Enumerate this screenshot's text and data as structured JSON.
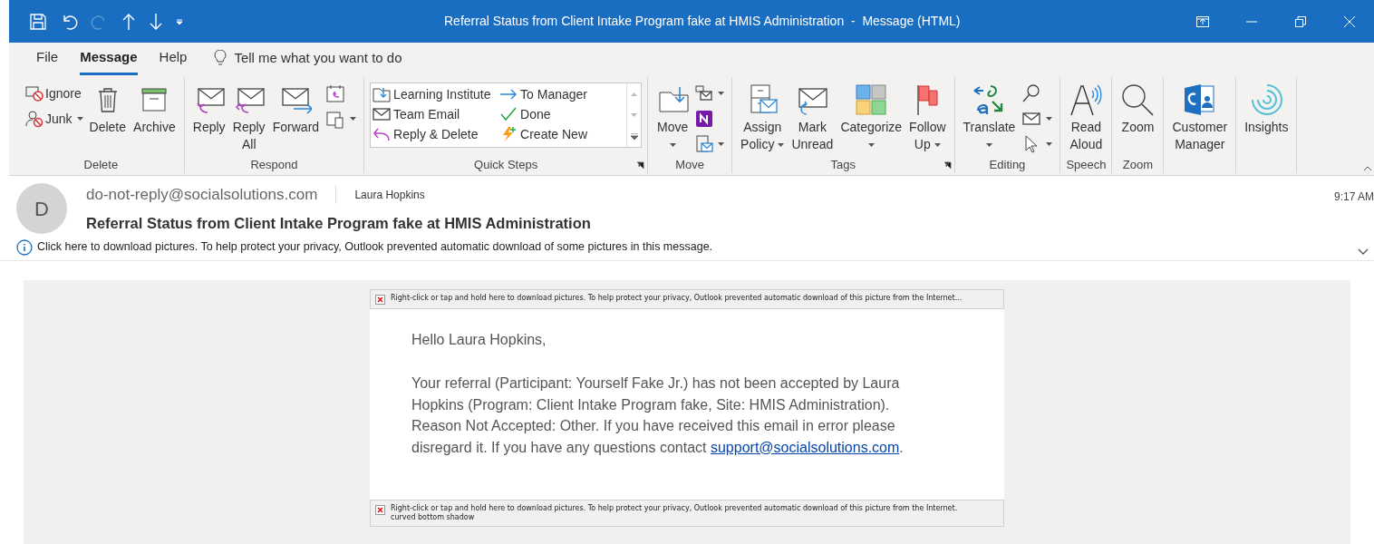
{
  "title_bar": {
    "title": "Referral Status from Client Intake Program fake at HMIS Administration  -  Message (HTML)"
  },
  "menu_tabs": [
    {
      "label": "File",
      "selected": false
    },
    {
      "label": "Message",
      "selected": true
    },
    {
      "label": "Help",
      "selected": false
    }
  ],
  "tell_me": {
    "placeholder": "Tell me what you want to do"
  },
  "ribbon": {
    "groups": [
      {
        "label": "Delete",
        "columns": [
          {
            "kind": "stack",
            "items": [
              {
                "lines": [
                  "Ignore"
                ],
                "dropdown": false
              },
              {
                "lines": [
                  "Junk"
                ],
                "dropdown": true
              }
            ]
          },
          {
            "kind": "large",
            "items": [
              {
                "lines": [
                  "Delete"
                ],
                "dropdown": false
              }
            ]
          },
          {
            "kind": "large",
            "items": [
              {
                "lines": [
                  "Archive"
                ],
                "dropdown": false
              }
            ]
          }
        ]
      },
      {
        "label": "Respond",
        "columns": [
          {
            "kind": "large",
            "items": [
              {
                "lines": [
                  "Reply"
                ],
                "dropdown": false
              }
            ]
          },
          {
            "kind": "large",
            "items": [
              {
                "lines": [
                  "Reply",
                  "All"
                ],
                "dropdown": false
              }
            ]
          },
          {
            "kind": "large",
            "items": [
              {
                "lines": [
                  "Forward"
                ],
                "dropdown": false
              }
            ]
          },
          {
            "kind": "stack",
            "items": [
              {
                "dropdown": false
              },
              {
                "dropdown": true
              }
            ]
          }
        ]
      },
      {
        "label": "Quick Steps",
        "launcher": true,
        "columns": [
          {
            "kind": "gallery",
            "items": [
              {
                "lines": [
                  "Learning Institute"
                ]
              },
              {
                "lines": [
                  "To Manager"
                ]
              },
              {
                "lines": [
                  "Team Email"
                ]
              },
              {
                "lines": [
                  "Done"
                ]
              },
              {
                "lines": [
                  "Reply & Delete"
                ]
              },
              {
                "lines": [
                  "Create New"
                ]
              }
            ]
          }
        ]
      },
      {
        "label": "Move",
        "columns": [
          {
            "kind": "large",
            "items": [
              {
                "lines": [
                  "Move"
                ],
                "dropdown": true
              }
            ]
          },
          {
            "kind": "stack",
            "items": [
              {
                "dropdown": true
              },
              {
                "dropdown": false
              },
              {
                "dropdown": true
              }
            ]
          }
        ]
      },
      {
        "label": "Tags",
        "launcher": true,
        "columns": [
          {
            "kind": "large",
            "items": [
              {
                "lines": [
                  "Assign",
                  "Policy"
                ],
                "dropdown": true
              }
            ]
          },
          {
            "kind": "large",
            "items": [
              {
                "lines": [
                  "Mark",
                  "Unread"
                ],
                "dropdown": false
              }
            ]
          },
          {
            "kind": "large",
            "items": [
              {
                "lines": [
                  "Categorize"
                ],
                "dropdown": true
              }
            ]
          },
          {
            "kind": "large",
            "items": [
              {
                "lines": [
                  "Follow",
                  "Up"
                ],
                "dropdown": true
              }
            ]
          }
        ]
      },
      {
        "label": "Editing",
        "columns": [
          {
            "kind": "large",
            "items": [
              {
                "lines": [
                  "Translate"
                ],
                "dropdown": true
              }
            ]
          },
          {
            "kind": "stack",
            "items": [
              {
                "dropdown": false
              },
              {
                "dropdown": true
              },
              {
                "dropdown": true
              }
            ]
          }
        ]
      },
      {
        "label": "Speech",
        "columns": [
          {
            "kind": "large",
            "items": [
              {
                "lines": [
                  "Read",
                  "Aloud"
                ],
                "dropdown": false
              }
            ]
          }
        ]
      },
      {
        "label": "Zoom",
        "columns": [
          {
            "kind": "large",
            "items": [
              {
                "lines": [
                  "Zoom"
                ],
                "dropdown": false
              }
            ]
          }
        ]
      },
      {
        "columns": [
          {
            "kind": "large",
            "items": [
              {
                "lines": [
                  "Customer",
                  "Manager"
                ],
                "dropdown": false
              }
            ]
          }
        ]
      },
      {
        "columns": [
          {
            "kind": "large",
            "items": [
              {
                "lines": [
                  "Insights"
                ],
                "dropdown": false
              }
            ]
          }
        ]
      }
    ]
  },
  "message": {
    "avatar": "D",
    "from": "do-not-reply@socialsolutions.com",
    "to": "Laura Hopkins",
    "time": "9:17 AM",
    "subject": "Referral Status from Client Intake Program fake at HMIS Administration",
    "info": "Click here to download pictures. To help protect your privacy, Outlook prevented automatic download of some pictures in this message."
  },
  "body": {
    "blocked_top": {
      "message": "Right-click or tap and hold here to download pictures. To help protect your privacy, Outlook prevented automatic download of this picture from the Internet..."
    },
    "greeting": "Hello Laura Hopkins,",
    "paragraph": "Your referral (Participant: Yourself Fake Jr.) has not been accepted by Laura Hopkins (Program: Client Intake Program fake, Site: HMIS Administration). Reason Not Accepted: Other. If you have received this email in error please disregard it. If you have any questions contact ",
    "link": "support@socialsolutions.com",
    "paragraph_end": ".",
    "blocked_bottom": {
      "message": "Right-click or tap and hold here to download pictures. To help protect your privacy, Outlook prevented automatic download of this picture from the Internet.",
      "alt_text": "curved bottom shadow"
    }
  }
}
